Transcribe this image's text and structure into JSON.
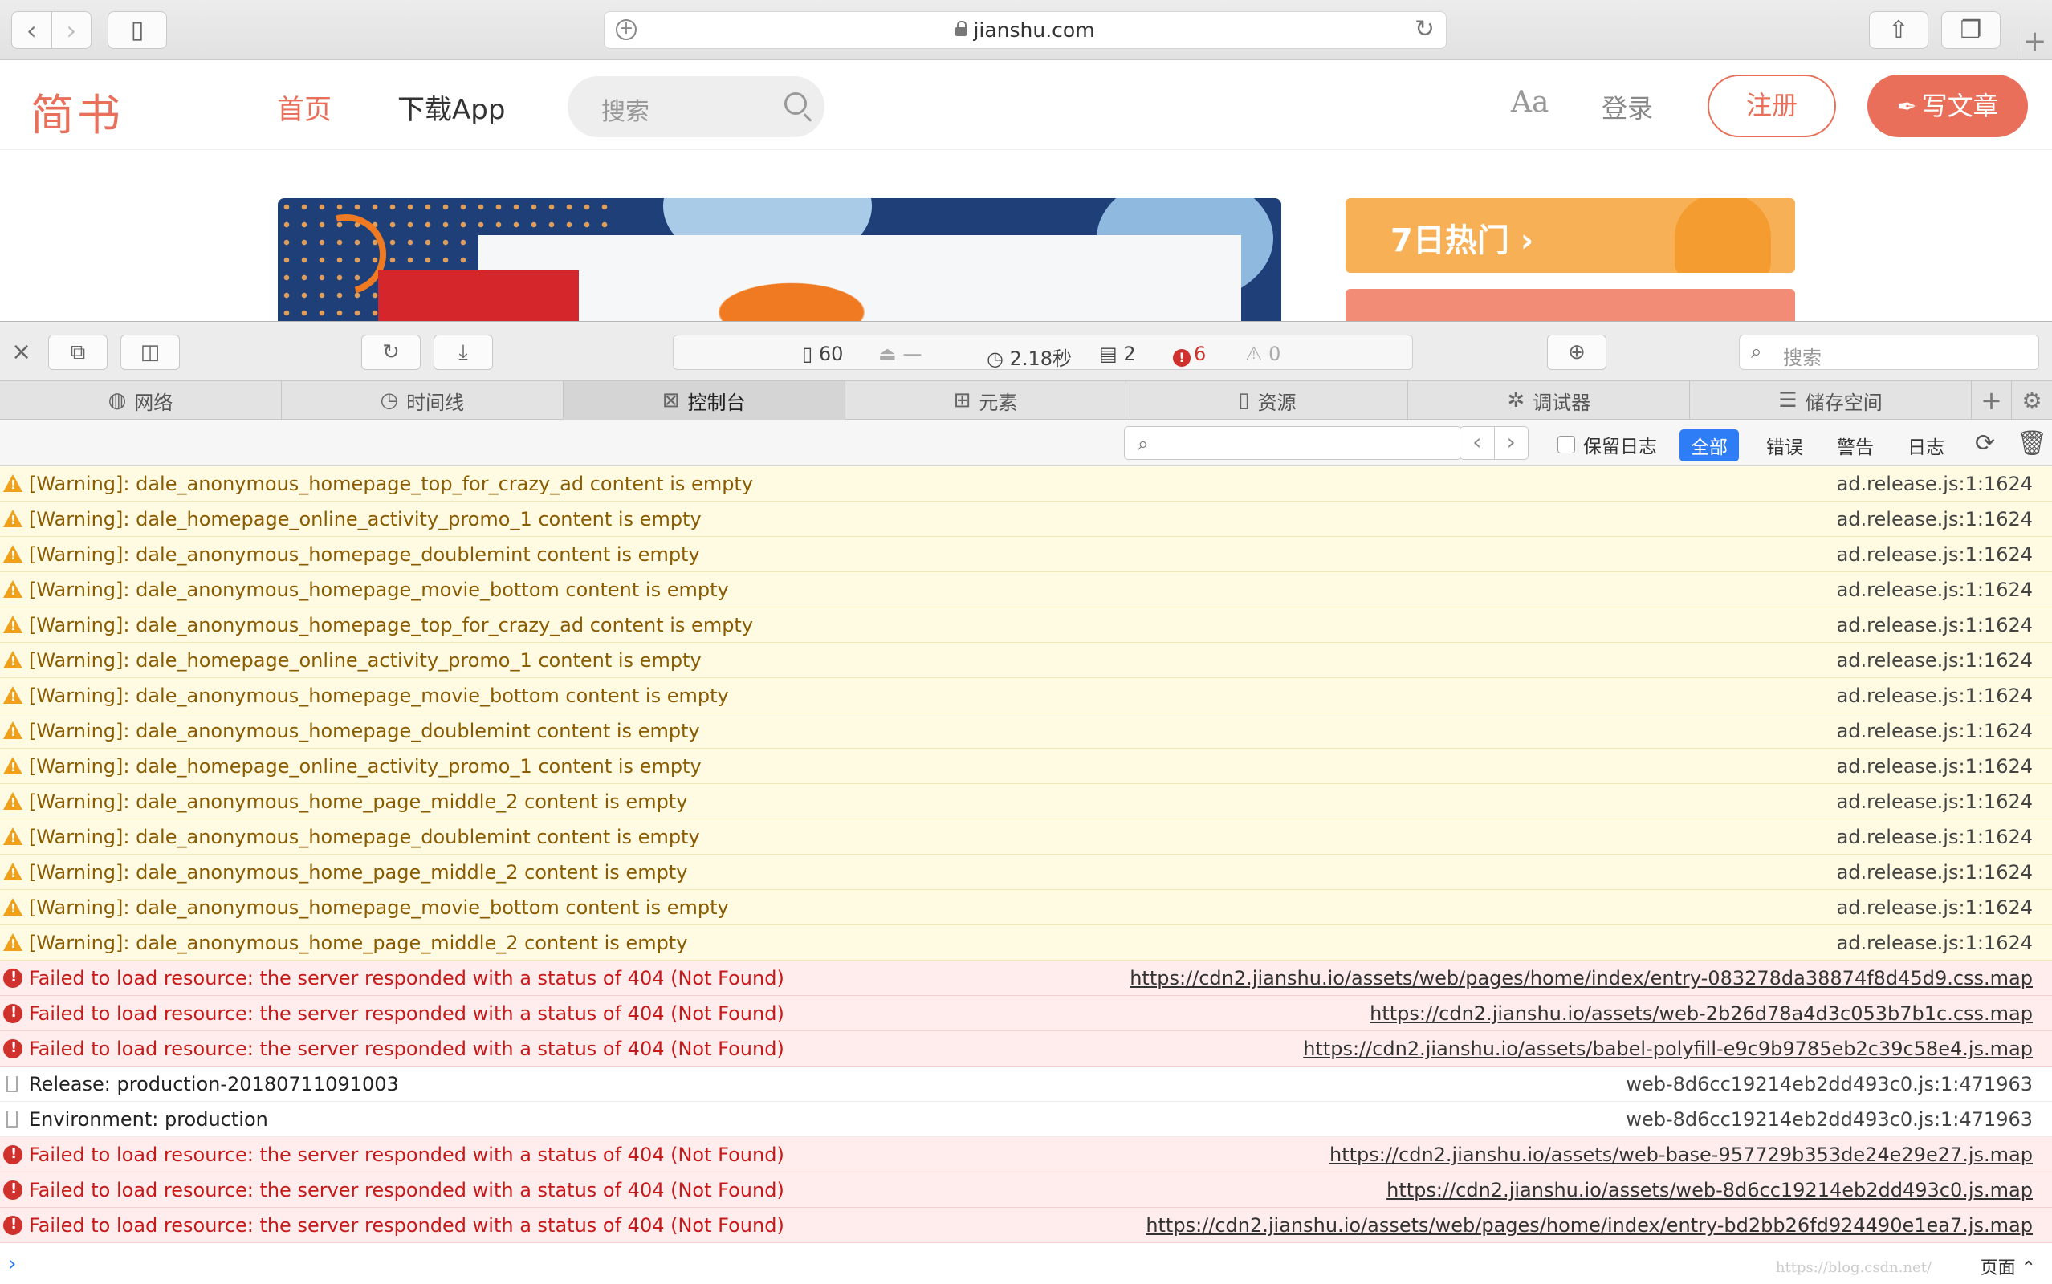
{
  "browser": {
    "url": "jianshu.com"
  },
  "site": {
    "logo": "简书",
    "nav_home": "首页",
    "nav_app": "下载App",
    "search_placeholder": "搜索",
    "font_toggle": "Aa",
    "login": "登录",
    "register": "注册",
    "write": "写文章",
    "hot7": "7日热门 ›",
    "accent_color": "#ea6f5a"
  },
  "inspector": {
    "stats": {
      "resources": "60",
      "size": "—",
      "load_time": "2.18秒",
      "messages": "2",
      "errors": "6",
      "warnings": "0"
    },
    "search_placeholder": "搜索",
    "tabs": [
      "网络",
      "时间线",
      "控制台",
      "元素",
      "资源",
      "调试器",
      "储存空间"
    ],
    "active_tab": "控制台",
    "filter": {
      "preserve_log": "保留日志",
      "levels": [
        "全部",
        "错误",
        "警告",
        "日志"
      ],
      "active_level": "全部"
    },
    "messages": [
      {
        "level": "warn",
        "text": "[Warning]: dale_anonymous_homepage_top_for_crazy_ad content is empty",
        "source": "ad.release.js:1:1624"
      },
      {
        "level": "warn",
        "text": "[Warning]: dale_homepage_online_activity_promo_1 content is empty",
        "source": "ad.release.js:1:1624"
      },
      {
        "level": "warn",
        "text": "[Warning]: dale_anonymous_homepage_doublemint content is empty",
        "source": "ad.release.js:1:1624"
      },
      {
        "level": "warn",
        "text": "[Warning]: dale_anonymous_homepage_movie_bottom content is empty",
        "source": "ad.release.js:1:1624"
      },
      {
        "level": "warn",
        "text": "[Warning]: dale_anonymous_homepage_top_for_crazy_ad content is empty",
        "source": "ad.release.js:1:1624"
      },
      {
        "level": "warn",
        "text": "[Warning]: dale_homepage_online_activity_promo_1 content is empty",
        "source": "ad.release.js:1:1624"
      },
      {
        "level": "warn",
        "text": "[Warning]: dale_anonymous_homepage_movie_bottom content is empty",
        "source": "ad.release.js:1:1624"
      },
      {
        "level": "warn",
        "text": "[Warning]: dale_anonymous_homepage_doublemint content is empty",
        "source": "ad.release.js:1:1624"
      },
      {
        "level": "warn",
        "text": "[Warning]: dale_homepage_online_activity_promo_1 content is empty",
        "source": "ad.release.js:1:1624"
      },
      {
        "level": "warn",
        "text": "[Warning]: dale_anonymous_home_page_middle_2 content is empty",
        "source": "ad.release.js:1:1624"
      },
      {
        "level": "warn",
        "text": "[Warning]: dale_anonymous_homepage_doublemint content is empty",
        "source": "ad.release.js:1:1624"
      },
      {
        "level": "warn",
        "text": "[Warning]: dale_anonymous_home_page_middle_2 content is empty",
        "source": "ad.release.js:1:1624"
      },
      {
        "level": "warn",
        "text": "[Warning]: dale_anonymous_homepage_movie_bottom content is empty",
        "source": "ad.release.js:1:1624"
      },
      {
        "level": "warn",
        "text": "[Warning]: dale_anonymous_home_page_middle_2 content is empty",
        "source": "ad.release.js:1:1624"
      },
      {
        "level": "error",
        "text": "Failed to load resource: the server responded with a status of 404 (Not Found)",
        "source": "https://cdn2.jianshu.io/assets/web/pages/home/index/entry-083278da38874f8d45d9.css.map"
      },
      {
        "level": "error",
        "text": "Failed to load resource: the server responded with a status of 404 (Not Found)",
        "source": "https://cdn2.jianshu.io/assets/web-2b26d78a4d3c053b7b1c.css.map"
      },
      {
        "level": "error",
        "text": "Failed to load resource: the server responded with a status of 404 (Not Found)",
        "source": "https://cdn2.jianshu.io/assets/babel-polyfill-e9c9b9785eb2c39c58e4.js.map"
      },
      {
        "level": "info",
        "text": "Release: production-20180711091003",
        "source": "web-8d6cc19214eb2dd493c0.js:1:471963"
      },
      {
        "level": "info",
        "text": "Environment: production",
        "source": "web-8d6cc19214eb2dd493c0.js:1:471963"
      },
      {
        "level": "error",
        "text": "Failed to load resource: the server responded with a status of 404 (Not Found)",
        "source": "https://cdn2.jianshu.io/assets/web-base-957729b353de24e29e27.js.map"
      },
      {
        "level": "error",
        "text": "Failed to load resource: the server responded with a status of 404 (Not Found)",
        "source": "https://cdn2.jianshu.io/assets/web-8d6cc19214eb2dd493c0.js.map"
      },
      {
        "level": "error",
        "text": "Failed to load resource: the server responded with a status of 404 (Not Found)",
        "source": "https://cdn2.jianshu.io/assets/web/pages/home/index/entry-bd2bb26fd924490e1ea7.js.map"
      }
    ],
    "execution_context": "页面 ⌃",
    "watermark": "https://blog.csdn.net/"
  }
}
